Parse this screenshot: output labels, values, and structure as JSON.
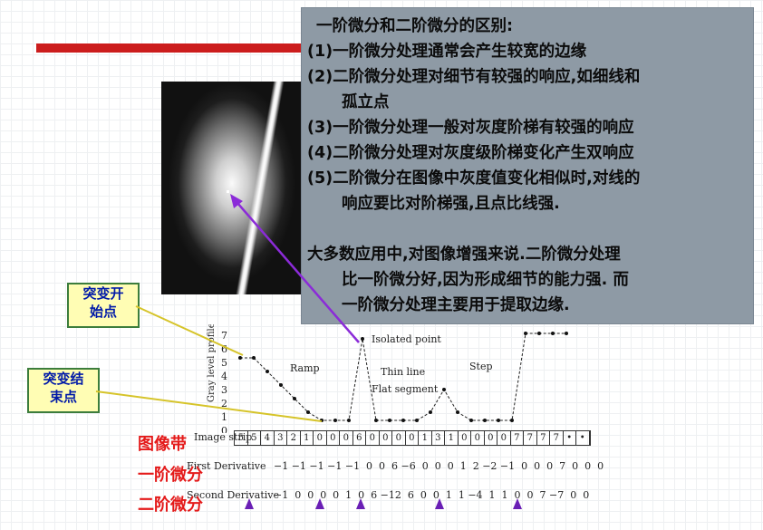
{
  "slide": {
    "title": "一阶微分和二阶微分的区别:",
    "points": [
      "(1)一阶微分处理通常会产生较宽的边缘",
      "(2)二阶微分处理对细节有较强的响应,如细线和",
      "孤立点",
      "(3)一阶微分处理一般对灰度阶梯有较强的响应",
      "(4)二阶微分处理对灰度级阶梯变化产生双响应",
      "(5)二阶微分在图像中灰度值变化相似时,对线的",
      "响应要比对阶梯强,且点比线强."
    ],
    "summary": [
      "大多数应用中,对图像增强来说.二阶微分处理",
      "比一阶微分好,因为形成细节的能力强. 而",
      "一阶微分处理主要用于提取边缘."
    ]
  },
  "callouts": {
    "start": [
      "突变开",
      "始点"
    ],
    "end": [
      "突变结",
      "束点"
    ]
  },
  "labels": {
    "strip_zh": "图像带",
    "first_zh": "一阶微分",
    "second_zh": "二阶微分"
  },
  "plot": {
    "ylabel": "Gray level profile",
    "yticks": [
      "7",
      "6",
      "5",
      "4",
      "3",
      "2",
      "1",
      "0"
    ],
    "annotations": [
      "Isolated point",
      "Ramp",
      "Thin line",
      "Flat segment",
      "Step"
    ]
  },
  "strip": {
    "label": "Image strip",
    "cells": [
      "5",
      "5",
      "4",
      "3",
      "2",
      "1",
      "0",
      "0",
      "0",
      "6",
      "0",
      "0",
      "0",
      "0",
      "1",
      "3",
      "1",
      "0",
      "0",
      "0",
      "0",
      "7",
      "7",
      "7",
      "7",
      "•",
      "•"
    ]
  },
  "derivatives": {
    "first_label": "First Derivative",
    "first": "−1 −1 −1 −1 −1  0  0  6 −6  0  0  0  1  2 −2 −1  0  0  0  7  0  0  0",
    "second_label": "Second Derivative",
    "second": "−1  0  0  0  0  1  0  6 −12  6  0  0  1  1 −4  1  1  0  0  7 −7  0  0"
  },
  "colors": {
    "bar": "#cc1d1d",
    "box": "#8e9aa5",
    "arrow": "#8b2bd8",
    "callout_bg": "#fffdb4",
    "marker": "#6a1fb5"
  }
}
